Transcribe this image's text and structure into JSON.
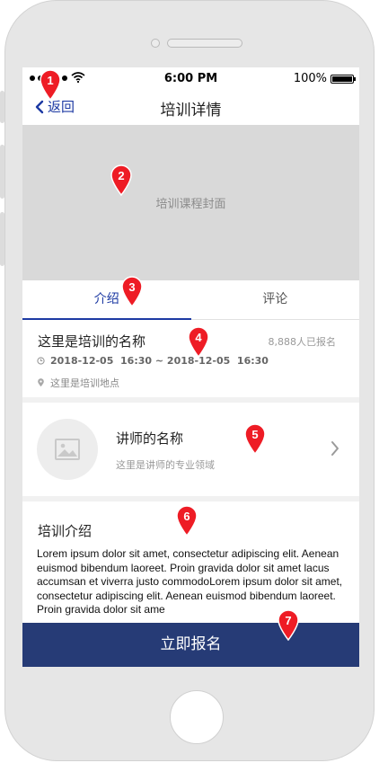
{
  "status_bar": {
    "time": "6:00 PM",
    "battery": "100%",
    "battery_level": 1.0
  },
  "nav": {
    "back_label": "返回",
    "title": "培训详情"
  },
  "cover": {
    "placeholder": "培训课程封面"
  },
  "tabs": [
    {
      "label": "介绍",
      "active": true
    },
    {
      "label": "评论",
      "active": false
    }
  ],
  "training": {
    "name": "这里是培训的名称",
    "signup_count": "8,888人已报名",
    "time_range": "2018-12-05  16:30 ~ 2018-12-05  16:30",
    "location": "这里是培训地点"
  },
  "lecturer": {
    "name": "讲师的名称",
    "field": "这里是讲师的专业领域"
  },
  "intro": {
    "title": "培训介绍",
    "body": "Lorem ipsum dolor sit amet, consectetur adipiscing elit. Aenean euismod bibendum laoreet. Proin gravida dolor sit amet lacus accumsan et viverra justo commodoLorem ipsum dolor sit amet, consectetur adipiscing elit. Aenean euismod bibendum laoreet. Proin gravida dolor sit ame"
  },
  "cta": {
    "label": "立即报名"
  },
  "annotations": [
    "1",
    "2",
    "3",
    "4",
    "5",
    "6",
    "7"
  ],
  "colors": {
    "accent": "#1d3aa3",
    "cta": "#263b76",
    "marker": "#ee1c25",
    "cover": "#d9d9d9"
  },
  "icons": {
    "back": "chevron-left-icon",
    "clock": "clock-icon",
    "location": "map-pin-icon",
    "avatar": "image-placeholder-icon",
    "arrow": "chevron-right-icon",
    "wifi": "wifi-icon"
  }
}
